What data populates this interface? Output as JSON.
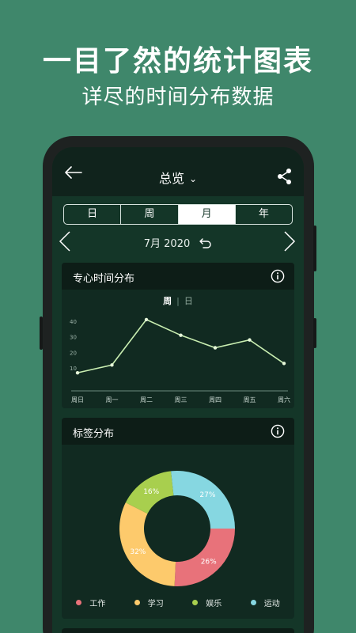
{
  "hero": {
    "title": "一目了然的统计图表",
    "subtitle": "详尽的时间分布数据"
  },
  "topbar": {
    "title": "总览",
    "chevron": "⌄",
    "back_icon": "arrow-left-icon",
    "share_icon": "share-icon"
  },
  "segments": [
    {
      "label": "日",
      "active": false
    },
    {
      "label": "周",
      "active": false
    },
    {
      "label": "月",
      "active": true
    },
    {
      "label": "年",
      "active": false
    }
  ],
  "month": {
    "label": "7月 2020"
  },
  "focus_card": {
    "title": "专心时间分布",
    "toggle": {
      "on": "周",
      "off": "日"
    }
  },
  "tag_card": {
    "title": "标签分布"
  },
  "colors": {
    "line": "#c9eeb1",
    "work": "#e8727a",
    "study": "#fdca6c",
    "fun": "#a8cf4e",
    "sport": "#86d7e1"
  },
  "chart_data": [
    {
      "type": "line",
      "title": "",
      "categories": [
        "周日",
        "周一",
        "周二",
        "周三",
        "周四",
        "周五",
        "周六"
      ],
      "values": [
        7,
        12,
        41,
        31,
        23,
        28,
        13
      ],
      "yticks": [
        10,
        20,
        30,
        40
      ],
      "ylim": [
        0,
        45
      ],
      "grid": false
    },
    {
      "type": "pie",
      "title": "",
      "labels": [
        "工作",
        "学习",
        "娱乐",
        "运动"
      ],
      "values": [
        26,
        32,
        16,
        27
      ],
      "value_labels": [
        "26%",
        "32%",
        "16%",
        "27%"
      ],
      "colors": [
        "#e8727a",
        "#fdca6c",
        "#a8cf4e",
        "#86d7e1"
      ],
      "legend": "bottom"
    }
  ]
}
